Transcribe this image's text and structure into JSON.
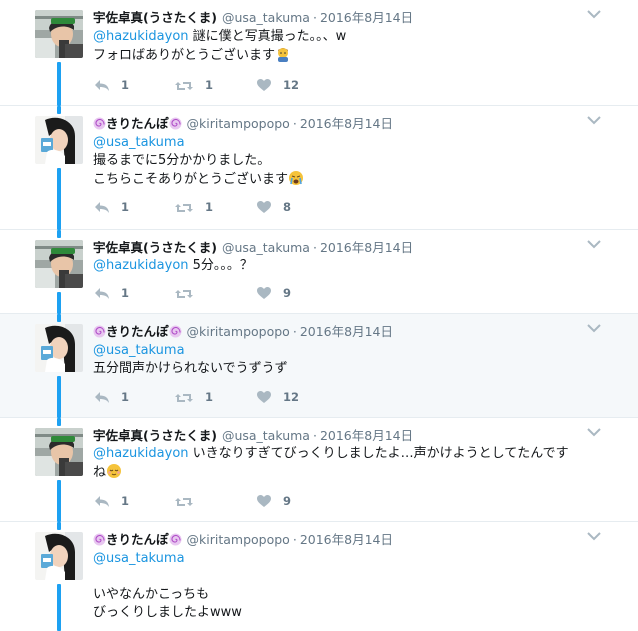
{
  "tweets": [
    {
      "name": "宇佐卓真(うさたくま)",
      "handle": "@usa_takuma",
      "sep": "·",
      "date": "2016年8月14日",
      "mention": "@hazukidayon",
      "text_after_mention": " 謎に僕と写真撮った。。、w",
      "lines": [
        "フォロばありがとうございます"
      ],
      "emoji": "person-emoji",
      "replies": "1",
      "retweets": "1",
      "likes": "12"
    },
    {
      "name": "きりたんぽ",
      "handle": "@kiritampopopo",
      "sep": "·",
      "date": "2016年8月14日",
      "mention": "@usa_takuma",
      "lines": [
        "撮るまでに5分かかりました。",
        "こちらこそありがとうございます"
      ],
      "emoji": "crying-face-emoji",
      "replies": "1",
      "retweets": "1",
      "likes": "8"
    },
    {
      "name": "宇佐卓真(うさたくま)",
      "handle": "@usa_takuma",
      "sep": "·",
      "date": "2016年8月14日",
      "mention": "@hazukidayon",
      "text_after_mention": " 5分。。。？",
      "replies": "1",
      "retweets": "",
      "likes": "9"
    },
    {
      "name": "きりたんぽ",
      "handle": "@kiritampopopo",
      "sep": "·",
      "date": "2016年8月14日",
      "mention": "@usa_takuma",
      "lines": [
        "五分間声かけられないでうずうず"
      ],
      "replies": "1",
      "retweets": "1",
      "likes": "12"
    },
    {
      "name": "宇佐卓真(うさたくま)",
      "handle": "@usa_takuma",
      "sep": "·",
      "date": "2016年8月14日",
      "mention": "@hazukidayon",
      "text_after_mention": " いきなりすぎてびっくりしましたよ…声かけようとしてたんです",
      "lines": [
        "ね"
      ],
      "emoji": "relieved-face-emoji",
      "replies": "1",
      "retweets": "",
      "likes": "9"
    },
    {
      "name": "きりたんぽ",
      "handle": "@kiritampopopo",
      "sep": "·",
      "date": "2016年8月14日",
      "mention": "@usa_takuma",
      "lines": [
        "",
        "いやなんかこっちも",
        "びっくりしましたよwww"
      ]
    }
  ],
  "colors": {
    "link": "#1b95e0",
    "thread_line": "#1da1f2",
    "muted": "#657786",
    "highlight_bg": "#f5f8fa"
  },
  "icons": {
    "reply": "reply-icon",
    "retweet": "retweet-icon",
    "like": "heart-icon",
    "caret": "chevron-down-icon",
    "name_decoration": "swirl-icon"
  }
}
